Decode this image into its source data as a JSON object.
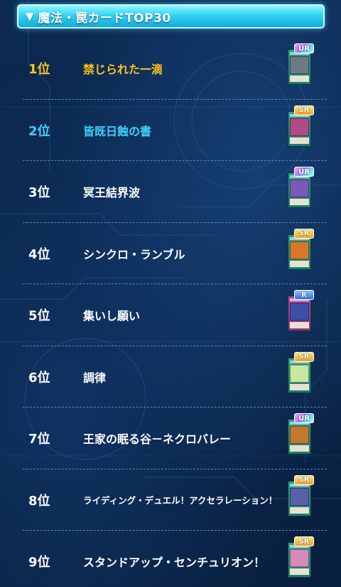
{
  "header": {
    "arrow": "▼",
    "title": "魔法・罠カードTOP30"
  },
  "colors": {
    "gold": "#ffc21a",
    "cyan": "#3fd2ff",
    "white": "#ffffff",
    "spell_card": "#2aa08e",
    "trap_card": "#c1449a"
  },
  "ranking": [
    {
      "rank": "1位",
      "name": "禁じられた一滴",
      "rarity": "UR",
      "card_type": "spell",
      "art_color": "#6d7a86"
    },
    {
      "rank": "2位",
      "name": "皆既日蝕の書",
      "rarity": "SR",
      "card_type": "spell",
      "art_color": "#b24a86"
    },
    {
      "rank": "3位",
      "name": "冥王結界波",
      "rarity": "UR",
      "card_type": "spell",
      "art_color": "#7a5ab8"
    },
    {
      "rank": "4位",
      "name": "シンクロ・ランブル",
      "rarity": "SR",
      "card_type": "spell",
      "art_color": "#d8772c"
    },
    {
      "rank": "5位",
      "name": "集いし願い",
      "rarity": "R",
      "card_type": "trap",
      "art_color": "#3c4fa8"
    },
    {
      "rank": "6位",
      "name": "調律",
      "rarity": "SR",
      "card_type": "spell",
      "art_color": "#c8e6a0"
    },
    {
      "rank": "7位",
      "name": "王家の眠る谷－ネクロバレー",
      "rarity": "UR",
      "card_type": "spell",
      "art_color": "#c2782f"
    },
    {
      "rank": "8位",
      "name": "ライディング・デュエル！アクセラレーション！",
      "rarity": "SR",
      "card_type": "spell",
      "art_color": "#5a5fa8"
    },
    {
      "rank": "9位",
      "name": "スタンドアップ・センチュリオン！",
      "rarity": "SR",
      "card_type": "spell",
      "art_color": "#d88ab8"
    }
  ]
}
